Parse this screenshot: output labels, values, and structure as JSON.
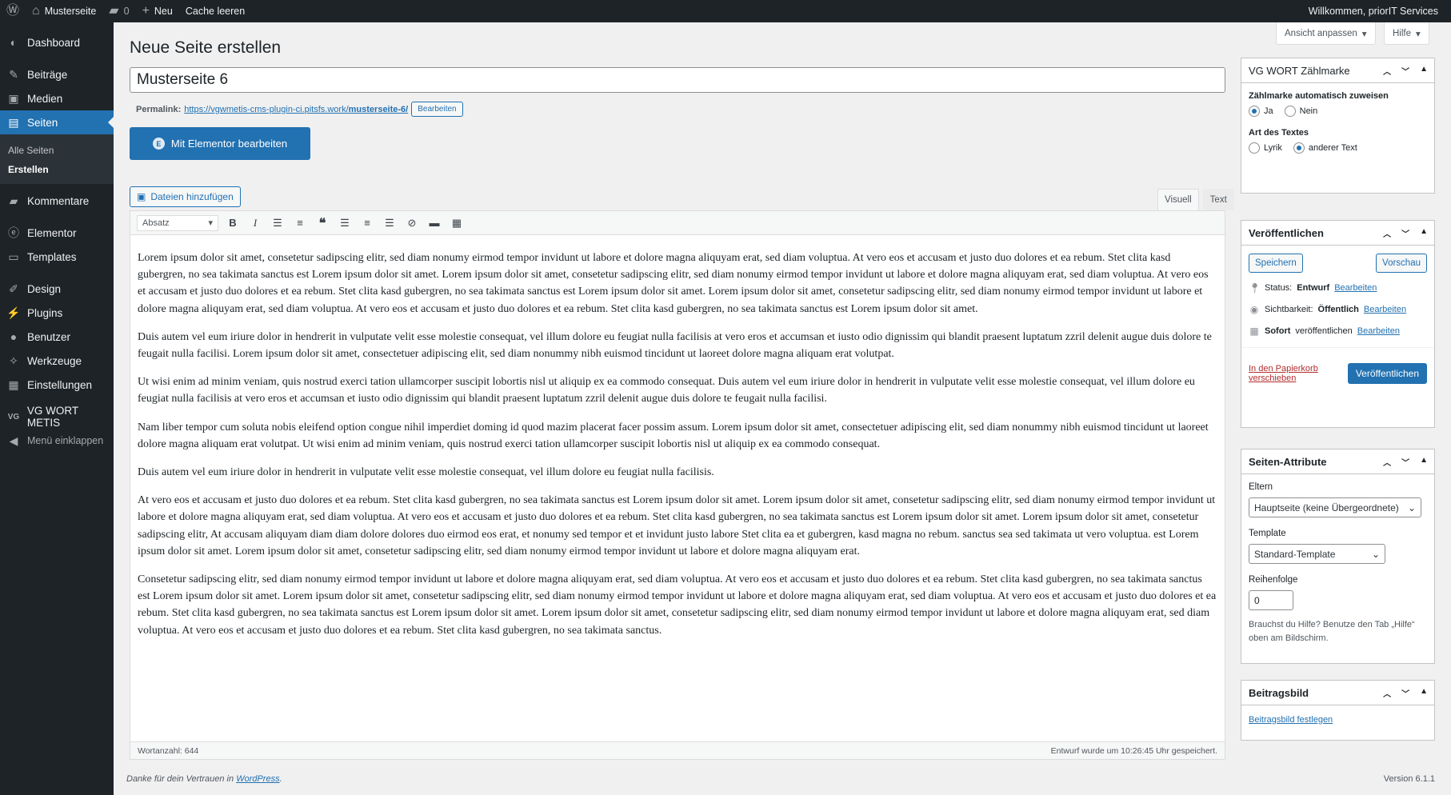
{
  "adminbar": {
    "site_name": "Musterseite",
    "comments_count": "0",
    "new_label": "Neu",
    "cache_label": "Cache leeren",
    "greeting": "Willkommen, priorIT Services"
  },
  "sidebar": {
    "items": [
      {
        "label": "Dashboard",
        "icon": "dashboard-icon"
      },
      {
        "label": "Beiträge",
        "icon": "pin-icon"
      },
      {
        "label": "Medien",
        "icon": "media-icon"
      },
      {
        "label": "Seiten",
        "icon": "page-icon"
      },
      {
        "label": "Kommentare",
        "icon": "comment-icon"
      },
      {
        "label": "Elementor",
        "icon": "elementor-icon"
      },
      {
        "label": "Templates",
        "icon": "folder-icon"
      },
      {
        "label": "Design",
        "icon": "brush-icon"
      },
      {
        "label": "Plugins",
        "icon": "plugin-icon"
      },
      {
        "label": "Benutzer",
        "icon": "user-icon"
      },
      {
        "label": "Werkzeuge",
        "icon": "wrench-icon"
      },
      {
        "label": "Einstellungen",
        "icon": "settings-icon"
      },
      {
        "label": "VG WORT METIS",
        "icon": "vgwort-icon"
      },
      {
        "label": "Menü einklappen",
        "icon": "collapse-icon"
      }
    ],
    "submenu": [
      "Alle Seiten",
      "Erstellen"
    ]
  },
  "header": {
    "title": "Neue Seite erstellen",
    "screen_options": "Ansicht anpassen",
    "help": "Hilfe"
  },
  "editor": {
    "post_title": "Musterseite 6",
    "permalink_label": "Permalink:",
    "permalink_url_base": "https://vgwmetis-cms-plugin-ci.pitsfs.work/",
    "permalink_slug": "musterseite-6/",
    "permalink_edit": "Bearbeiten",
    "elementor_button": "Mit Elementor bearbeiten",
    "media_button": "Dateien hinzufügen",
    "tab_visual": "Visuell",
    "tab_text": "Text",
    "format_select": "Absatz",
    "paragraphs": [
      "Lorem ipsum dolor sit amet, consetetur sadipscing elitr, sed diam nonumy eirmod tempor invidunt ut labore et dolore magna aliquyam erat, sed diam voluptua. At vero eos et accusam et justo duo dolores et ea rebum. Stet clita kasd gubergren, no sea takimata sanctus est Lorem ipsum dolor sit amet. Lorem ipsum dolor sit amet, consetetur sadipscing elitr, sed diam nonumy eirmod tempor invidunt ut labore et dolore magna aliquyam erat, sed diam voluptua. At vero eos et accusam et justo duo dolores et ea rebum. Stet clita kasd gubergren, no sea takimata sanctus est Lorem ipsum dolor sit amet. Lorem ipsum dolor sit amet, consetetur sadipscing elitr, sed diam nonumy eirmod tempor invidunt ut labore et dolore magna aliquyam erat, sed diam voluptua. At vero eos et accusam et justo duo dolores et ea rebum. Stet clita kasd gubergren, no sea takimata sanctus est Lorem ipsum dolor sit amet.",
      "Duis autem vel eum iriure dolor in hendrerit in vulputate velit esse molestie consequat, vel illum dolore eu feugiat nulla facilisis at vero eros et accumsan et iusto odio dignissim qui blandit praesent luptatum zzril delenit augue duis dolore te feugait nulla facilisi. Lorem ipsum dolor sit amet, consectetuer adipiscing elit, sed diam nonummy nibh euismod tincidunt ut laoreet dolore magna aliquam erat volutpat.",
      "Ut wisi enim ad minim veniam, quis nostrud exerci tation ullamcorper suscipit lobortis nisl ut aliquip ex ea commodo consequat. Duis autem vel eum iriure dolor in hendrerit in vulputate velit esse molestie consequat, vel illum dolore eu feugiat nulla facilisis at vero eros et accumsan et iusto odio dignissim qui blandit praesent luptatum zzril delenit augue duis dolore te feugait nulla facilisi.",
      "Nam liber tempor cum soluta nobis eleifend option congue nihil imperdiet doming id quod mazim placerat facer possim assum. Lorem ipsum dolor sit amet, consectetuer adipiscing elit, sed diam nonummy nibh euismod tincidunt ut laoreet dolore magna aliquam erat volutpat. Ut wisi enim ad minim veniam, quis nostrud exerci tation ullamcorper suscipit lobortis nisl ut aliquip ex ea commodo consequat.",
      "Duis autem vel eum iriure dolor in hendrerit in vulputate velit esse molestie consequat, vel illum dolore eu feugiat nulla facilisis.",
      "At vero eos et accusam et justo duo dolores et ea rebum. Stet clita kasd gubergren, no sea takimata sanctus est Lorem ipsum dolor sit amet. Lorem ipsum dolor sit amet, consetetur sadipscing elitr, sed diam nonumy eirmod tempor invidunt ut labore et dolore magna aliquyam erat, sed diam voluptua. At vero eos et accusam et justo duo dolores et ea rebum. Stet clita kasd gubergren, no sea takimata sanctus est Lorem ipsum dolor sit amet. Lorem ipsum dolor sit amet, consetetur sadipscing elitr, At accusam aliquyam diam diam dolore dolores duo eirmod eos erat, et nonumy sed tempor et et invidunt justo labore Stet clita ea et gubergren, kasd magna no rebum. sanctus sea sed takimata ut vero voluptua. est Lorem ipsum dolor sit amet. Lorem ipsum dolor sit amet, consetetur sadipscing elitr, sed diam nonumy eirmod tempor invidunt ut labore et dolore magna aliquyam erat.",
      "Consetetur sadipscing elitr, sed diam nonumy eirmod tempor invidunt ut labore et dolore magna aliquyam erat, sed diam voluptua. At vero eos et accusam et justo duo dolores et ea rebum. Stet clita kasd gubergren, no sea takimata sanctus est Lorem ipsum dolor sit amet. Lorem ipsum dolor sit amet, consetetur sadipscing elitr, sed diam nonumy eirmod tempor invidunt ut labore et dolore magna aliquyam erat, sed diam voluptua. At vero eos et accusam et justo duo dolores et ea rebum. Stet clita kasd gubergren, no sea takimata sanctus est Lorem ipsum dolor sit amet. Lorem ipsum dolor sit amet, consetetur sadipscing elitr, sed diam nonumy eirmod tempor invidunt ut labore et dolore magna aliquyam erat, sed diam voluptua. At vero eos et accusam et justo duo dolores et ea rebum. Stet clita kasd gubergren, no sea takimata sanctus."
    ],
    "word_count": "Wortanzahl: 644",
    "draft_saved": "Entwurf wurde um 10:26:45 Uhr gespeichert."
  },
  "vgwort_box": {
    "title": "VG WORT Zählmarke",
    "auto_label": "Zählmarke automatisch zuweisen",
    "yes": "Ja",
    "no": "Nein",
    "type_label": "Art des Textes",
    "lyric": "Lyrik",
    "other": "anderer Text"
  },
  "publish_box": {
    "title": "Veröffentlichen",
    "save": "Speichern",
    "preview": "Vorschau",
    "status_label": "Status:",
    "status_value": "Entwurf",
    "visibility_label": "Sichtbarkeit:",
    "visibility_value": "Öffentlich",
    "schedule_value": "Sofort",
    "schedule_label": "veröffentlichen",
    "edit": "Bearbeiten",
    "trash": "In den Papierkorb verschieben",
    "publish": "Veröffentlichen"
  },
  "attributes_box": {
    "title": "Seiten-Attribute",
    "parent_label": "Eltern",
    "parent_value": "Hauptseite (keine Übergeordnete)",
    "template_label": "Template",
    "template_value": "Standard-Template",
    "order_label": "Reihenfolge",
    "order_value": "0",
    "help": "Brauchst du Hilfe? Benutze den Tab „Hilfe“ oben am Bildschirm."
  },
  "featured_box": {
    "title": "Beitragsbild",
    "set_link": "Beitragsbild festlegen"
  },
  "footer": {
    "thanks": "Danke für dein Vertrauen in",
    "wp_link": "WordPress",
    "period": ".",
    "version": "Version 6.1.1"
  },
  "colors": {
    "accent": "#2271b1",
    "admin_dark": "#1d2327",
    "trash": "#b32d2e"
  }
}
